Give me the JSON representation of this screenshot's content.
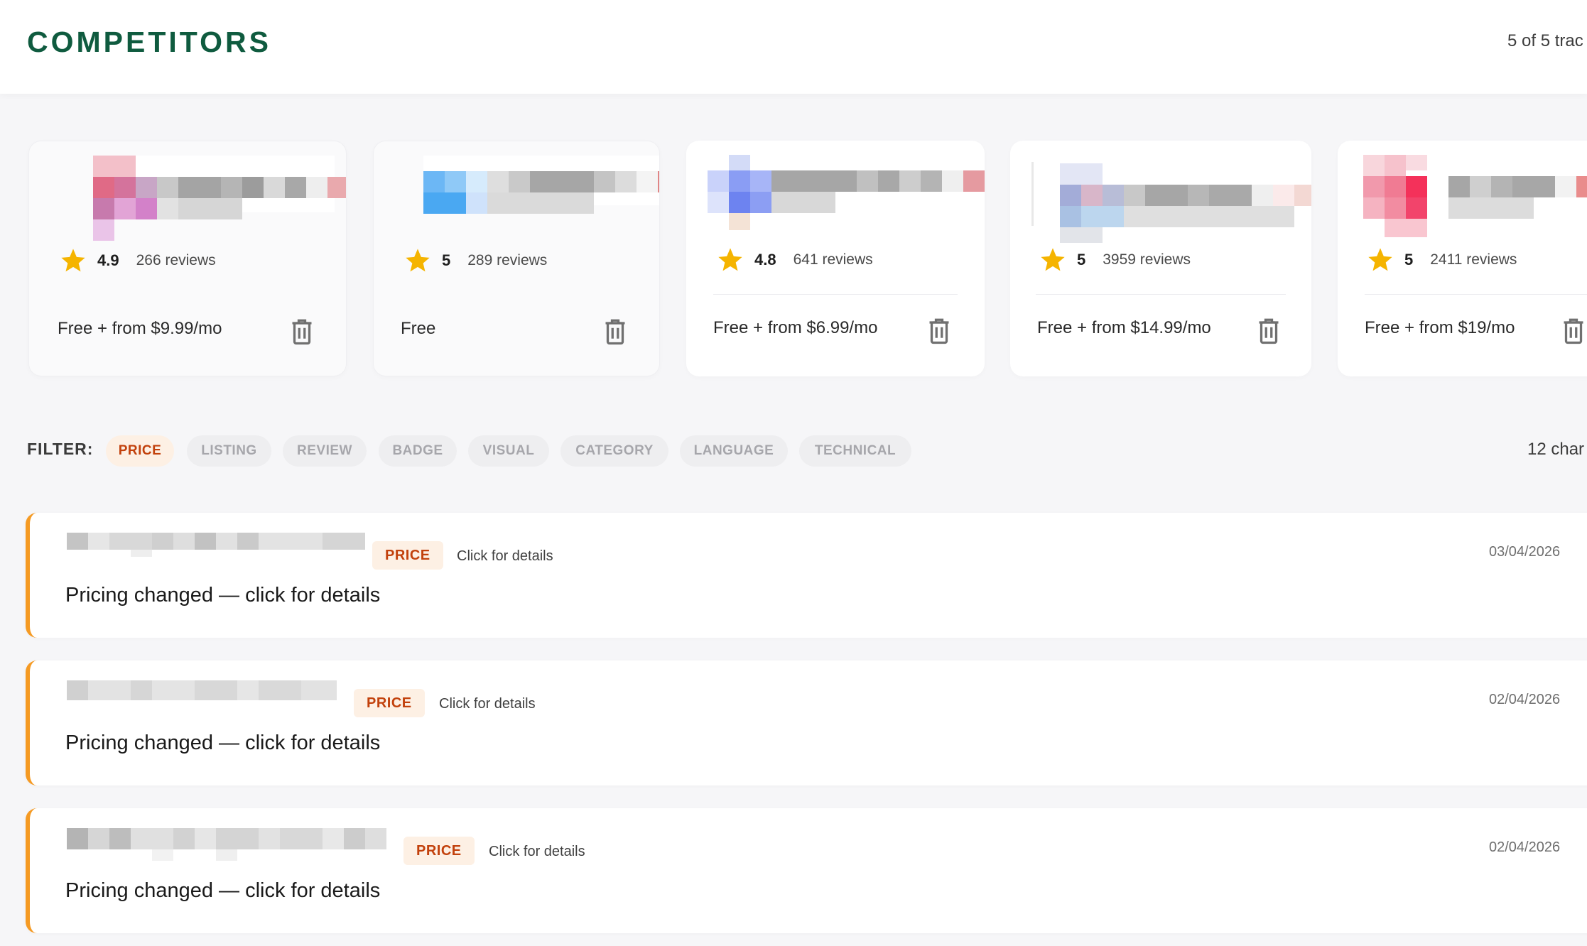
{
  "header": {
    "title": "COMPETITORS",
    "tracked_text": "5 of 5 trac"
  },
  "competitors": [
    {
      "rating": "4.9",
      "reviews": "266 reviews",
      "pricing": "Free + from $9.99/mo"
    },
    {
      "rating": "5",
      "reviews": "289 reviews",
      "pricing": "Free"
    },
    {
      "rating": "4.8",
      "reviews": "641 reviews",
      "pricing": "Free + from $6.99/mo"
    },
    {
      "rating": "5",
      "reviews": "3959 reviews",
      "pricing": "Free + from $14.99/mo"
    },
    {
      "rating": "5",
      "reviews": "2411 reviews",
      "pricing": "Free + from $19/mo"
    }
  ],
  "filter": {
    "label": "FILTER:",
    "chips": [
      "PRICE",
      "LISTING",
      "REVIEW",
      "BADGE",
      "VISUAL",
      "CATEGORY",
      "LANGUAGE",
      "TECHNICAL"
    ],
    "active": "PRICE",
    "count_text": "12 char"
  },
  "changes": [
    {
      "badge": "PRICE",
      "hint": "Click for details",
      "date": "03/04/2026",
      "message": "Pricing changed — click for details"
    },
    {
      "badge": "PRICE",
      "hint": "Click for details",
      "date": "02/04/2026",
      "message": "Pricing changed — click for details"
    },
    {
      "badge": "PRICE",
      "hint": "Click for details",
      "date": "02/04/2026",
      "message": "Pricing changed — click for details"
    }
  ],
  "colors": {
    "brand_green": "#0f5b3f",
    "accent_orange": "#f59a23",
    "badge_text": "#c2410c",
    "badge_bg": "#fdf0e4",
    "star": "#f5b400"
  },
  "icons": {
    "rating": "star-icon",
    "delete": "trash-icon"
  }
}
